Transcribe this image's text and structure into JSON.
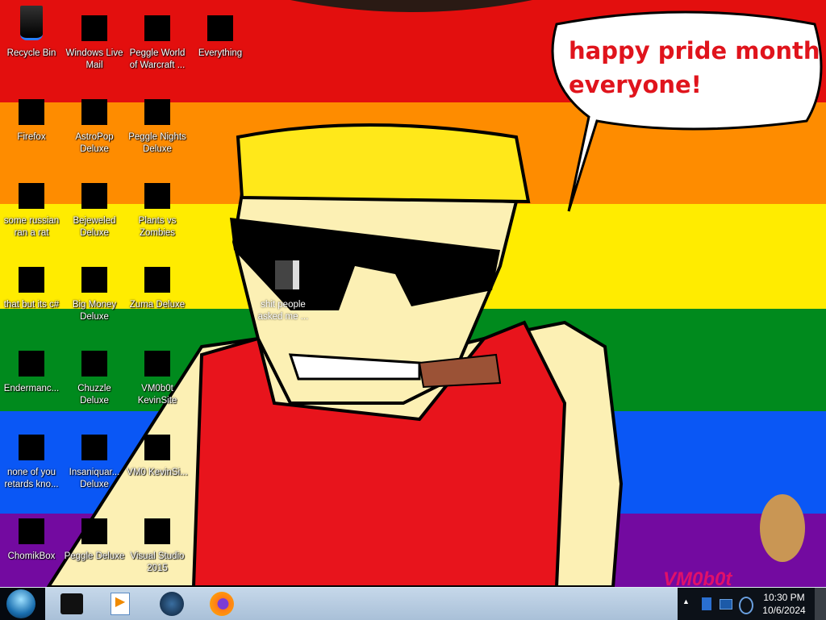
{
  "wallpaper": {
    "stripe_colors": [
      "#e30f0e",
      "#fe8c00",
      "#ffec00",
      "#008a1d",
      "#0a57f5",
      "#730aa0"
    ],
    "speech_bubble": [
      "happy pride month",
      "everyone!"
    ],
    "signature": "VM0b0t"
  },
  "desktop_icons": [
    {
      "label": "Recycle Bin",
      "icon": "recycle-bin-icon"
    },
    {
      "label": "Windows Live Mail",
      "icon": "mail-icon"
    },
    {
      "label": "Peggle World of Warcraft ...",
      "icon": "peggle-icon"
    },
    {
      "label": "Everything",
      "icon": "search-icon"
    },
    {
      "label": "Firefox",
      "icon": "firefox-icon"
    },
    {
      "label": "AstroPop Deluxe",
      "icon": "game-icon"
    },
    {
      "label": "Peggle Nights Deluxe",
      "icon": "peggle-icon"
    },
    {
      "label": "some russian ran a rat",
      "icon": "app-icon"
    },
    {
      "label": "Bejeweled Deluxe",
      "icon": "gem-icon"
    },
    {
      "label": "Plants vs Zombies",
      "icon": "plant-icon"
    },
    {
      "label": "that but its c#",
      "icon": "window-stack-icon"
    },
    {
      "label": "Big Money Deluxe",
      "icon": "money-bag-icon"
    },
    {
      "label": "Zuma Deluxe",
      "icon": "zuma-icon"
    },
    {
      "label": "Endermanc...",
      "icon": "terminal-icon"
    },
    {
      "label": "Chuzzle Deluxe",
      "icon": "chuzzle-icon"
    },
    {
      "label": "VM0b0t KevinSite",
      "icon": "visual-studio-icon"
    },
    {
      "label": "none of you retards kno...",
      "icon": "opera-icon"
    },
    {
      "label": "Insaniquar... Deluxe",
      "icon": "fish-icon"
    },
    {
      "label": "VM0 KevinSi...",
      "icon": "document-icon"
    },
    {
      "label": "ChomikBox",
      "icon": "hamster-icon"
    },
    {
      "label": "Peggle Deluxe",
      "icon": "peggle-icon"
    },
    {
      "label": "Visual Studio 2015",
      "icon": "visual-studio-icon"
    },
    {
      "label": "shit people asked me ...",
      "icon": "folder-icon"
    }
  ],
  "taskbar": {
    "pinned": [
      "terminal-app",
      "media-player",
      "steam",
      "firefox"
    ],
    "clock": {
      "time": "10:30 PM",
      "date": "10/6/2024"
    }
  }
}
